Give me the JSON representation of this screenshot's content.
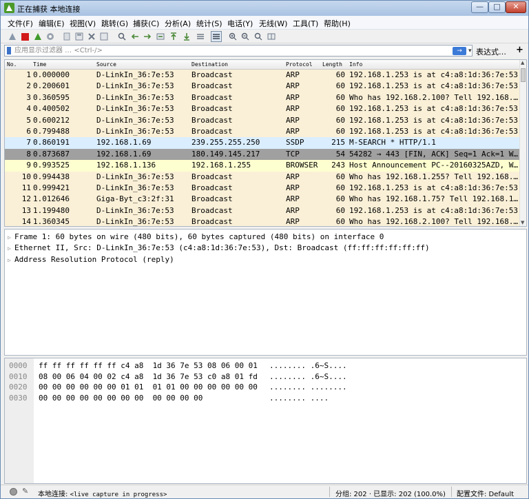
{
  "window": {
    "title": "正在捕获 本地连接",
    "min_label": "—",
    "max_label": "□",
    "close_label": "✕"
  },
  "menu": [
    "文件(F)",
    "编辑(E)",
    "视图(V)",
    "跳转(G)",
    "捕获(C)",
    "分析(A)",
    "统计(S)",
    "电话(Y)",
    "无线(W)",
    "工具(T)",
    "帮助(H)"
  ],
  "toolbar_icons": [
    "shark-fin-icon",
    "stop-icon",
    "restart-icon",
    "options-icon",
    "open-icon",
    "save-icon",
    "close-file-icon",
    "reload-icon",
    "find-icon",
    "back-icon",
    "forward-icon",
    "goto-icon",
    "first-packet-icon",
    "last-packet-icon",
    "autoscroll-icon",
    "colorize-icon",
    "zoom-in-icon",
    "zoom-out-icon",
    "zoom-normal-icon",
    "resize-columns-icon"
  ],
  "filter": {
    "placeholder": "应用显示过滤器 … <Ctrl-/>",
    "apply_label": "→",
    "dropdown_label": "▾",
    "expression_label": "表达式…",
    "add_label": "+"
  },
  "packet_list": {
    "columns": [
      "No.",
      "Time",
      "Source",
      "Destination",
      "Protocol",
      "Length",
      "Info"
    ],
    "rows": [
      {
        "no": "1",
        "time": "0.000000",
        "src": "D-LinkIn_36:7e:53",
        "dst": "Broadcast",
        "proto": "ARP",
        "len": "60",
        "info": "192.168.1.253 is at c4:a8:1d:36:7e:53",
        "bg": "#faf0d7"
      },
      {
        "no": "2",
        "time": "0.200601",
        "src": "D-LinkIn_36:7e:53",
        "dst": "Broadcast",
        "proto": "ARP",
        "len": "60",
        "info": "192.168.1.253 is at c4:a8:1d:36:7e:53",
        "bg": "#faf0d7"
      },
      {
        "no": "3",
        "time": "0.360595",
        "src": "D-LinkIn_36:7e:53",
        "dst": "Broadcast",
        "proto": "ARP",
        "len": "60",
        "info": "Who has 192.168.2.100? Tell 192.168.…",
        "bg": "#faf0d7"
      },
      {
        "no": "4",
        "time": "0.400502",
        "src": "D-LinkIn_36:7e:53",
        "dst": "Broadcast",
        "proto": "ARP",
        "len": "60",
        "info": "192.168.1.253 is at c4:a8:1d:36:7e:53",
        "bg": "#faf0d7"
      },
      {
        "no": "5",
        "time": "0.600212",
        "src": "D-LinkIn_36:7e:53",
        "dst": "Broadcast",
        "proto": "ARP",
        "len": "60",
        "info": "192.168.1.253 is at c4:a8:1d:36:7e:53",
        "bg": "#faf0d7"
      },
      {
        "no": "6",
        "time": "0.799488",
        "src": "D-LinkIn_36:7e:53",
        "dst": "Broadcast",
        "proto": "ARP",
        "len": "60",
        "info": "192.168.1.253 is at c4:a8:1d:36:7e:53",
        "bg": "#faf0d7"
      },
      {
        "no": "7",
        "time": "0.860191",
        "src": "192.168.1.69",
        "dst": "239.255.255.250",
        "proto": "SSDP",
        "len": "215",
        "info": "M-SEARCH * HTTP/1.1",
        "bg": "#daeeff"
      },
      {
        "no": "8",
        "time": "0.873687",
        "src": "192.168.1.69",
        "dst": "180.149.145.217",
        "proto": "TCP",
        "len": "54",
        "info": "54282 → 443 [FIN, ACK] Seq=1 Ack=1 W…",
        "bg": "#a0a0a0"
      },
      {
        "no": "9",
        "time": "0.993525",
        "src": "192.168.1.136",
        "dst": "192.168.1.255",
        "proto": "BROWSER",
        "len": "243",
        "info": "Host Announcement PC--20160325AZD, W…",
        "bg": "#feffd0"
      },
      {
        "no": "10",
        "time": "0.994438",
        "src": "D-LinkIn_36:7e:53",
        "dst": "Broadcast",
        "proto": "ARP",
        "len": "60",
        "info": "Who has 192.168.1.255? Tell 192.168.…",
        "bg": "#faf0d7"
      },
      {
        "no": "11",
        "time": "0.999421",
        "src": "D-LinkIn_36:7e:53",
        "dst": "Broadcast",
        "proto": "ARP",
        "len": "60",
        "info": "192.168.1.253 is at c4:a8:1d:36:7e:53",
        "bg": "#faf0d7"
      },
      {
        "no": "12",
        "time": "1.012646",
        "src": "Giga-Byt_c3:2f:31",
        "dst": "Broadcast",
        "proto": "ARP",
        "len": "60",
        "info": "Who has 192.168.1.75? Tell 192.168.1…",
        "bg": "#faf0d7"
      },
      {
        "no": "13",
        "time": "1.199480",
        "src": "D-LinkIn_36:7e:53",
        "dst": "Broadcast",
        "proto": "ARP",
        "len": "60",
        "info": "192.168.1.253 is at c4:a8:1d:36:7e:53",
        "bg": "#faf0d7"
      },
      {
        "no": "14",
        "time": "1.360345",
        "src": "D-LinkIn_36:7e:53",
        "dst": "Broadcast",
        "proto": "ARP",
        "len": "60",
        "info": "Who has 192.168.2.100? Tell 192.168.…",
        "bg": "#faf0d7"
      }
    ]
  },
  "details": [
    "Frame 1: 60 bytes on wire (480 bits), 60 bytes captured (480 bits) on interface 0",
    "Ethernet II, Src: D-LinkIn_36:7e:53 (c4:a8:1d:36:7e:53), Dst: Broadcast (ff:ff:ff:ff:ff:ff)",
    "Address Resolution Protocol (reply)"
  ],
  "bytes": [
    {
      "offset": "0000",
      "hex": "ff ff ff ff ff ff c4 a8  1d 36 7e 53 08 06 00 01",
      "ascii": "........ .6~S...."
    },
    {
      "offset": "0010",
      "hex": "08 00 06 04 00 02 c4 a8  1d 36 7e 53 c0 a8 01 fd",
      "ascii": "........ .6~S...."
    },
    {
      "offset": "0020",
      "hex": "00 00 00 00 00 00 01 01  01 01 00 00 00 00 00 00",
      "ascii": "........ ........"
    },
    {
      "offset": "0030",
      "hex": "00 00 00 00 00 00 00 00  00 00 00 00",
      "ascii": "........ ...."
    }
  ],
  "status": {
    "edit_icon": "✎",
    "interface_label": "本地连接:",
    "capture_state": "<live capture in progress>",
    "counts": "分组: 202 · 已显示: 202 (100.0%)",
    "profile": "配置文件: Default"
  },
  "colors": {
    "arp_row": "#faf0d7",
    "ssdp_row": "#daeeff",
    "tcp_fin_row": "#a0a0a0",
    "browser_row": "#feffd0"
  }
}
